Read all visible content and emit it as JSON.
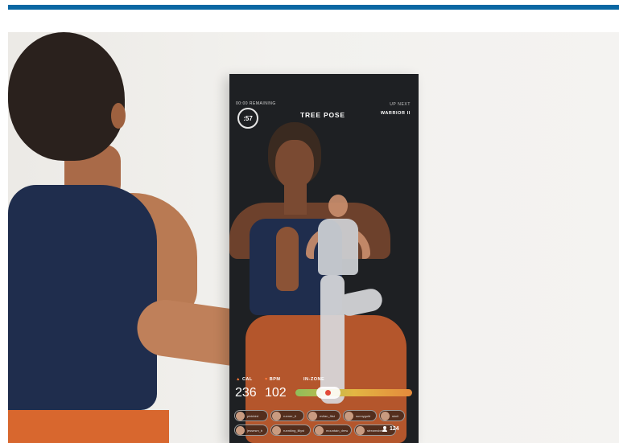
{
  "hud": {
    "remaining_label": "00:00 REMAINING",
    "timer": ":57",
    "pose": "TREE POSE",
    "up_next_label": "UP NEXT",
    "up_next_value": "WARRIOR II"
  },
  "metrics": {
    "cal_label": "CAL",
    "cal_value": "236",
    "bpm_label": "BPM",
    "bpm_value": "102",
    "zone_label": "IN-ZONE",
    "zone_level": 0.28
  },
  "leaderboard": {
    "users": [
      "pinkbird",
      "runner_lil",
      "evilan_fitst",
      "sunnygold",
      "sknit",
      "jessesm_b",
      "runnking_lillyst",
      "mountain_drew",
      "streamsbelle"
    ],
    "member_count": "124"
  },
  "colors": {
    "top_bar": "#0a67a3",
    "mirror_bg": "#1e2023",
    "accent": "#ff7a3a"
  },
  "icons": [
    "flame-icon",
    "heart-icon",
    "member-icon"
  ]
}
